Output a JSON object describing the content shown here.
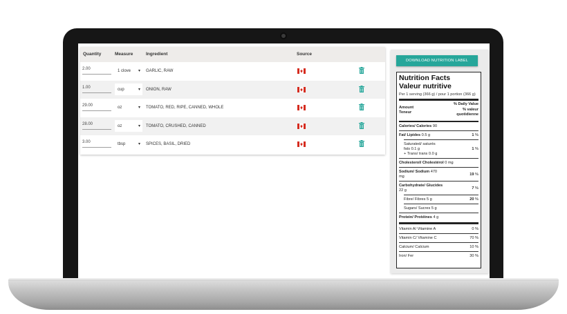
{
  "ingredients_table": {
    "headers": {
      "quantity": "Quantity",
      "measure": "Measure",
      "ingredient": "Ingredient",
      "source": "Source"
    },
    "rows": [
      {
        "quantity": "2.00",
        "measure": "1 clove",
        "ingredient": "GARLIC, RAW",
        "source": "canada-flag-icon"
      },
      {
        "quantity": "1.00",
        "measure": "cup",
        "ingredient": "ONION, RAW",
        "source": "canada-flag-icon"
      },
      {
        "quantity": "29.00",
        "measure": "oz",
        "ingredient": "TOMATO, RED, RIPE, CANNED, WHOLE",
        "source": "canada-flag-icon"
      },
      {
        "quantity": "28.00",
        "measure": "oz",
        "ingredient": "TOMATO, CRUSHED, CANNED",
        "source": "canada-flag-icon"
      },
      {
        "quantity": "3.00",
        "measure": "tbsp",
        "ingredient": "SPICES, BASIL, DRIED",
        "source": "canada-flag-icon"
      }
    ],
    "caret": "▾",
    "delete_icon": "trash-icon"
  },
  "nutrition": {
    "download_label": "DOWNLOAD NUTRITION LABEL",
    "title_en": "Nutrition Facts",
    "title_fr": "Valeur nutritive",
    "serving": "Per 1 serving (366 g) / pour 1 portion (366 g)",
    "amount_en": "Amount",
    "amount_fr": "Teneur",
    "dv_line1": "% Daily Value",
    "dv_line2": "% valeur",
    "dv_line3": "quotidienne",
    "calories": {
      "label": "Calories/ Calories",
      "value": "90"
    },
    "fat": {
      "label": "Fat/ Lipides",
      "value": "0.5 g",
      "pct": "1",
      "unit": "%"
    },
    "sat_trans": {
      "line1": "Saturated/ saturés",
      "line2": "fats 0.1 g",
      "line3": "+ Trans/ trans 0.0 g",
      "pct": "1",
      "unit": "%"
    },
    "cholesterol": {
      "label": "Cholesterol/ Cholestérol",
      "value": "0 mg"
    },
    "sodium": {
      "label": "Sodium/ Sodium",
      "value": "470",
      "value2": "mg",
      "pct": "19",
      "unit": "%"
    },
    "carbs": {
      "label": "Carbohydrate/ Glucides",
      "value": "22 g",
      "pct": "7",
      "unit": "%"
    },
    "fibre": {
      "label": "Fibre/ Fibres",
      "value": "5 g",
      "pct": "20",
      "unit": "%"
    },
    "sugars": {
      "label": "Sugars/ Sucres",
      "value": "5 g"
    },
    "protein": {
      "label": "Protein/ Protéines",
      "value": "4 g"
    },
    "vitamins": [
      {
        "label": "Vitamin A/ Vitamine A",
        "pct": "0 %"
      },
      {
        "label": "Vitamin C/ Vitamine C",
        "pct": "70 %"
      },
      {
        "label": "Calcium/ Calcium",
        "pct": "10 %"
      },
      {
        "label": "Iron/ Fer",
        "pct": "30 %"
      }
    ]
  },
  "colors": {
    "accent": "#26a69a",
    "flag_red": "#d52b1e",
    "header_bg": "#eeecea",
    "row_alt": "#f1f1f1"
  }
}
